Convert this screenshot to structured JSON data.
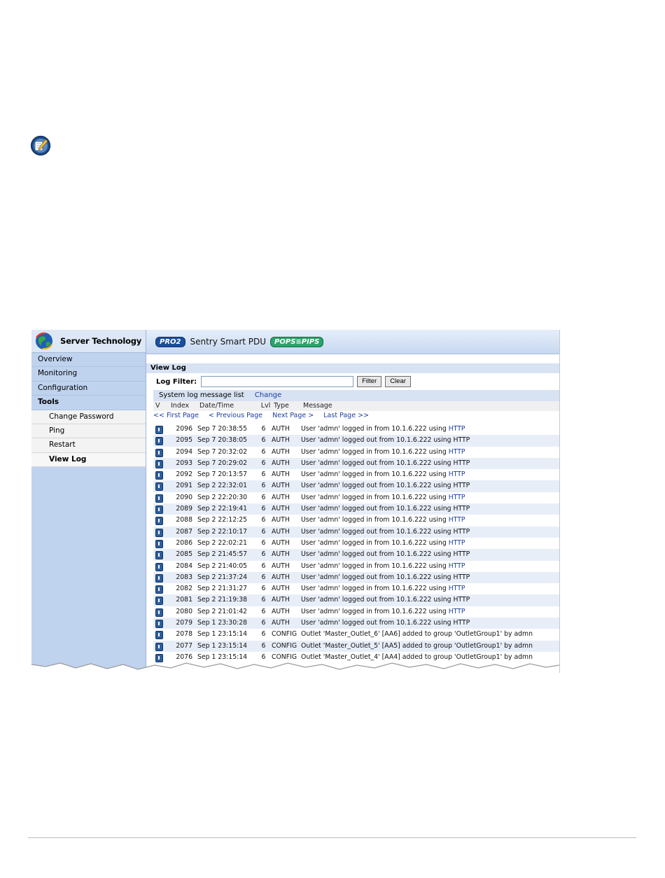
{
  "sidebar": {
    "brand": "Server Technology",
    "items": [
      {
        "label": "Overview"
      },
      {
        "label": "Monitoring"
      },
      {
        "label": "Configuration"
      },
      {
        "label": "Tools"
      }
    ],
    "tools_sub": [
      {
        "label": "Change Password"
      },
      {
        "label": "Ping"
      },
      {
        "label": "Restart"
      },
      {
        "label": "View Log"
      }
    ]
  },
  "header": {
    "pro_badge": "PRO2",
    "title": "Sentry Smart PDU",
    "pops_badge": "POPS≡PIPS"
  },
  "page": {
    "section_title": "View Log",
    "filter_label": "Log Filter:",
    "filter_value": "",
    "filter_button": "Filter",
    "clear_button": "Clear",
    "list_title": "System log message list",
    "list_change": "Change"
  },
  "columns": [
    "V",
    "Index",
    "Date/Time",
    "Lvl",
    "Type",
    "Message"
  ],
  "pager": {
    "first": "<< First Page",
    "previous": "< Previous Page",
    "next": "Next Page >",
    "last": "Last Page >>"
  },
  "log_rows": [
    {
      "index": "2096",
      "datetime": "Sep 7 20:38:55",
      "lvl": "6",
      "type": "AUTH",
      "message": "User 'admn' logged in from 10.1.6.222 using ",
      "proto": "HTTP"
    },
    {
      "index": "2095",
      "datetime": "Sep 7 20:38:05",
      "lvl": "6",
      "type": "AUTH",
      "message": "User 'admn' logged out from 10.1.6.222 using HTTP",
      "proto": ""
    },
    {
      "index": "2094",
      "datetime": "Sep 7 20:32:02",
      "lvl": "6",
      "type": "AUTH",
      "message": "User 'admn' logged in from 10.1.6.222 using ",
      "proto": "HTTP"
    },
    {
      "index": "2093",
      "datetime": "Sep 7 20:29:02",
      "lvl": "6",
      "type": "AUTH",
      "message": "User 'admn' logged out from 10.1.6.222 using HTTP",
      "proto": ""
    },
    {
      "index": "2092",
      "datetime": "Sep 7 20:13:57",
      "lvl": "6",
      "type": "AUTH",
      "message": "User 'admn' logged in from 10.1.6.222 using ",
      "proto": "HTTP"
    },
    {
      "index": "2091",
      "datetime": "Sep 2 22:32:01",
      "lvl": "6",
      "type": "AUTH",
      "message": "User 'admn' logged out from 10.1.6.222 using HTTP",
      "proto": ""
    },
    {
      "index": "2090",
      "datetime": "Sep 2 22:20:30",
      "lvl": "6",
      "type": "AUTH",
      "message": "User 'admn' logged in from 10.1.6.222 using ",
      "proto": "HTTP"
    },
    {
      "index": "2089",
      "datetime": "Sep 2 22:19:41",
      "lvl": "6",
      "type": "AUTH",
      "message": "User 'admn' logged out from 10.1.6.222 using HTTP",
      "proto": ""
    },
    {
      "index": "2088",
      "datetime": "Sep 2 22:12:25",
      "lvl": "6",
      "type": "AUTH",
      "message": "User 'admn' logged in from 10.1.6.222 using ",
      "proto": "HTTP"
    },
    {
      "index": "2087",
      "datetime": "Sep 2 22:10:17",
      "lvl": "6",
      "type": "AUTH",
      "message": "User 'admn' logged out from 10.1.6.222 using HTTP",
      "proto": ""
    },
    {
      "index": "2086",
      "datetime": "Sep 2 22:02:21",
      "lvl": "6",
      "type": "AUTH",
      "message": "User 'admn' logged in from 10.1.6.222 using ",
      "proto": "HTTP"
    },
    {
      "index": "2085",
      "datetime": "Sep 2 21:45:57",
      "lvl": "6",
      "type": "AUTH",
      "message": "User 'admn' logged out from 10.1.6.222 using HTTP",
      "proto": ""
    },
    {
      "index": "2084",
      "datetime": "Sep 2 21:40:05",
      "lvl": "6",
      "type": "AUTH",
      "message": "User 'admn' logged in from 10.1.6.222 using ",
      "proto": "HTTP"
    },
    {
      "index": "2083",
      "datetime": "Sep 2 21:37:24",
      "lvl": "6",
      "type": "AUTH",
      "message": "User 'admn' logged out from 10.1.6.222 using HTTP",
      "proto": ""
    },
    {
      "index": "2082",
      "datetime": "Sep 2 21:31:27",
      "lvl": "6",
      "type": "AUTH",
      "message": "User 'admn' logged in from 10.1.6.222 using ",
      "proto": "HTTP"
    },
    {
      "index": "2081",
      "datetime": "Sep 2 21:19:38",
      "lvl": "6",
      "type": "AUTH",
      "message": "User 'admn' logged out from 10.1.6.222 using HTTP",
      "proto": ""
    },
    {
      "index": "2080",
      "datetime": "Sep 2 21:01:42",
      "lvl": "6",
      "type": "AUTH",
      "message": "User 'admn' logged in from 10.1.6.222 using ",
      "proto": "HTTP"
    },
    {
      "index": "2079",
      "datetime": "Sep 1 23:30:28",
      "lvl": "6",
      "type": "AUTH",
      "message": "User 'admn' logged out from 10.1.6.222 using HTTP",
      "proto": ""
    },
    {
      "index": "2078",
      "datetime": "Sep 1 23:15:14",
      "lvl": "6",
      "type": "CONFIG",
      "message": "Outlet 'Master_Outlet_6' [AA6] added to group 'OutletGroup1' by admn",
      "proto": ""
    },
    {
      "index": "2077",
      "datetime": "Sep 1 23:15:14",
      "lvl": "6",
      "type": "CONFIG",
      "message": "Outlet 'Master_Outlet_5' [AA5] added to group 'OutletGroup1' by admn",
      "proto": ""
    },
    {
      "index": "2076",
      "datetime": "Sep 1 23:15:14",
      "lvl": "6",
      "type": "CONFIG",
      "message": "Outlet 'Master_Outlet_4' [AA4] added to group 'OutletGroup1' by admn",
      "proto": ""
    }
  ],
  "icons": {
    "note": "pencil-note-icon",
    "row": "info-icon",
    "logo": "globe-logo-icon"
  },
  "colors": {
    "sidebar_bg": "#bfd3ee",
    "header_bg": "#d7e2f3",
    "link": "#1a3fa0",
    "row_alt": "#e8eef8"
  }
}
